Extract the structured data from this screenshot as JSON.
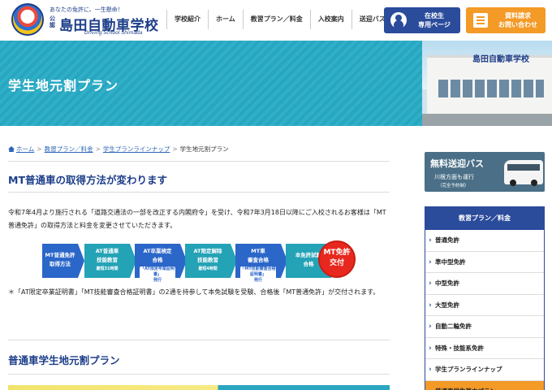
{
  "header": {
    "tagline": "あなたの免許に、一生懸命！",
    "koken": "公認",
    "school_name": "島田自動車学校",
    "school_name_en": "Driving School Shimada",
    "nav": [
      "学校紹介",
      "ホーム",
      "教習プラン／料金",
      "入校案内",
      "送迎バス"
    ],
    "student_button": "在校生\n専用ページ",
    "request_button": "資料請求\nお問い合わせ"
  },
  "hero": {
    "title": "学生地元割プラン",
    "building_sign": "島田自動車学校"
  },
  "breadcrumb": {
    "home": "ホーム",
    "level1": "教習プラン／料金",
    "level2": "学生プランラインナップ",
    "current": "学生地元割プラン"
  },
  "section1": {
    "heading": "MT普通車の取得方法が変わります",
    "paragraph": "令和7年4月より施行される「道路交通法の一部を改正する内閣府令」を受け、令和7年3月18日以降にご入校されるお客様は「MT普通免許」の取得方法と料金を変更させていただきます。",
    "note": "＊「AT限定卒業証明書」「MT技能審査合格証明書」の2通を持参して本免試験を受験、合格後「MT普通免許」が交付されます。"
  },
  "flow": {
    "steps": [
      {
        "label": "MT普通免許\n取得方法",
        "sub": "",
        "color": "#2b66c9"
      },
      {
        "label": "AT普通車\n技能教習",
        "sub": "最短31時間",
        "color": "#24a2b6"
      },
      {
        "label": "AT卒業検定\n合格",
        "sub": "「AT限定卒業証明書」\n発行",
        "color": "#2b66c9"
      },
      {
        "label": "AT限定解除\n技能教習",
        "sub": "最短4時間",
        "color": "#24a2b6"
      },
      {
        "label": "MT車\n審査合格",
        "sub": "「MT技能審査合格証明書」\n発行",
        "color": "#2b66c9"
      },
      {
        "label": "本免許試験\n合格",
        "sub": "",
        "color": "#24a2b6"
      }
    ],
    "final": "MT免許\n交付"
  },
  "section2": {
    "heading": "普通車学生地元割プラン"
  },
  "sidebar": {
    "bus_title": "無料送迎バス",
    "bus_line1": "川根方面も運行",
    "bus_line2": "（完全予約制）",
    "menu_title": "教習プラン／料金",
    "menu_items": [
      "普通免許",
      "準中型免許",
      "中型免許",
      "大型免許",
      "自動二輪免許",
      "特殊・技能系免許",
      "学生プランラインナップ",
      "普通車学生基本プラン"
    ]
  }
}
